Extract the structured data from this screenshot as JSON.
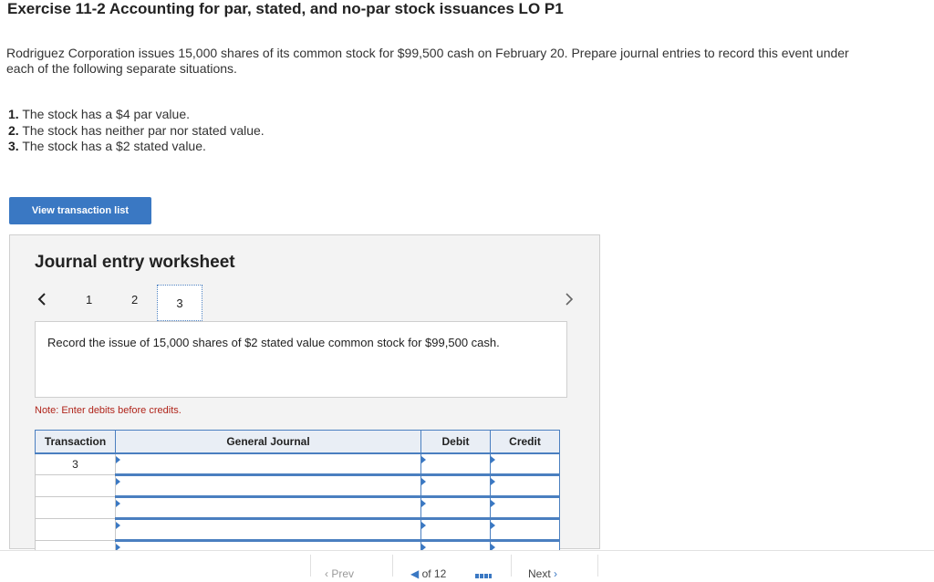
{
  "header": {
    "title": "Exercise 11-2 Accounting for par, stated, and no-par stock issuances LO P1"
  },
  "intro": "Rodriguez Corporation issues 15,000 shares of its common stock for $99,500 cash on February 20. Prepare journal entries to record this event under each of the following separate situations.",
  "requirements": [
    {
      "num": "1.",
      "text": "The stock has a $4 par value."
    },
    {
      "num": "2.",
      "text": "The stock has neither par nor stated value."
    },
    {
      "num": "3.",
      "text": "The stock has a $2 stated value."
    }
  ],
  "view_button_label": "View transaction list",
  "worksheet": {
    "title": "Journal entry worksheet",
    "pages": [
      "1",
      "2",
      "3"
    ],
    "active_page": "3",
    "instruction": "Record the issue of 15,000 shares of $2 stated value common stock for $99,500 cash.",
    "note": "Note: Enter debits before credits.",
    "table": {
      "headers": {
        "transaction": "Transaction",
        "journal": "General Journal",
        "debit": "Debit",
        "credit": "Credit"
      },
      "rows": [
        {
          "transaction": "3"
        },
        {
          "transaction": ""
        },
        {
          "transaction": ""
        },
        {
          "transaction": ""
        },
        {
          "transaction": ""
        }
      ]
    }
  },
  "footer": {
    "prev_label": "Prev",
    "page_of": "of 12",
    "next_label": "Next"
  }
}
